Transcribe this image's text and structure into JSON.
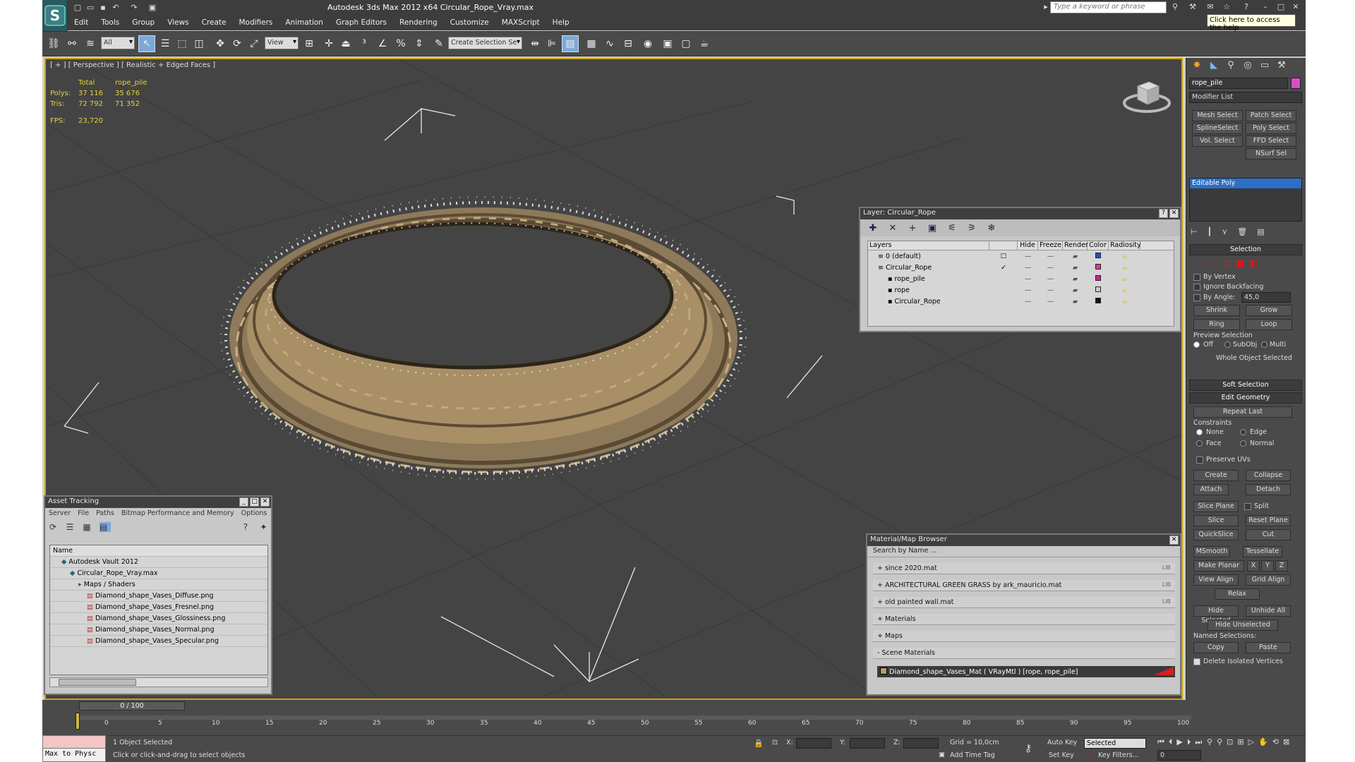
{
  "titlebar": {
    "title": "Autodesk 3ds Max  2012 x64     Circular_Rope_Vray.max",
    "search_placeholder": "Type a keyword or phrase",
    "tooltip": "Click here to access the help"
  },
  "menu": [
    "Edit",
    "Tools",
    "Group",
    "Views",
    "Create",
    "Modifiers",
    "Animation",
    "Graph Editors",
    "Rendering",
    "Customize",
    "MAXScript",
    "Help"
  ],
  "toolbar": {
    "filter": "All",
    "refcoord": "View",
    "selection_set": "Create Selection Se"
  },
  "viewport": {
    "label": "[ + ] [ Perspective ] [ Realistic + Edged Faces ]",
    "stats": {
      "total_label": "Total",
      "obj_label": "rope_pile",
      "polys_label": "Polys:",
      "polys_total": "37 116",
      "polys_obj": "35 676",
      "tris_label": "Tris:",
      "tris_total": "72 792",
      "tris_obj": "71 352",
      "fps_label": "FPS:",
      "fps": "23,720"
    }
  },
  "layer_dialog": {
    "title": "Layer: Circular_Rope",
    "columns": [
      "Layers",
      "Hide",
      "Freeze",
      "Render",
      "Color",
      "Radiosity"
    ],
    "rows": [
      {
        "name": "0 (default)",
        "indent": 0,
        "color": "#1f4fd8"
      },
      {
        "name": "Circular_Rope",
        "indent": 0,
        "color": "#d83aa0"
      },
      {
        "name": "rope_pile",
        "indent": 1,
        "color": "#d41f9e"
      },
      {
        "name": "rope",
        "indent": 1,
        "color": "#c8c8c8"
      },
      {
        "name": "Circular_Rope",
        "indent": 1,
        "color": "#111111"
      }
    ]
  },
  "asset_dialog": {
    "title": "Asset Tracking",
    "menu": [
      "Server",
      "File",
      "Paths",
      "Bitmap Performance and Memory",
      "Options"
    ],
    "column": "Name",
    "rows": [
      {
        "label": "Autodesk Vault 2012",
        "indent": 1
      },
      {
        "label": "Circular_Rope_Vray.max",
        "indent": 2
      },
      {
        "label": "Maps / Shaders",
        "indent": 3
      },
      {
        "label": "Diamond_shape_Vases_Diffuse.png",
        "indent": 4
      },
      {
        "label": "Diamond_shape_Vases_Fresnel.png",
        "indent": 4
      },
      {
        "label": "Diamond_shape_Vases_Glossiness.png",
        "indent": 4
      },
      {
        "label": "Diamond_shape_Vases_Normal.png",
        "indent": 4
      },
      {
        "label": "Diamond_shape_Vases_Specular.png",
        "indent": 4
      }
    ]
  },
  "material_dialog": {
    "title": "Material/Map Browser",
    "search": "Search by Name ...",
    "lib_tag": "LIB",
    "groups": [
      {
        "label": "+ since 2020.mat",
        "lib": true
      },
      {
        "label": "+ ARCHITECTURAL GREEN GRASS by ark_mauricio.mat",
        "lib": true
      },
      {
        "label": "+ old painted wall.mat",
        "lib": true
      },
      {
        "label": "+ Materials",
        "lib": false
      },
      {
        "label": "+ Maps",
        "lib": false
      },
      {
        "label": "- Scene Materials",
        "lib": false
      }
    ],
    "scene_material": "Diamond_shape_Vases_Mat  ( VRayMtl )  [rope, rope_pile]"
  },
  "command_panel": {
    "object_name": "rope_pile",
    "object_color": "#d94dca",
    "modifier_list": "Modifier List",
    "mod_buttons": [
      "Mesh Select",
      "Patch Select",
      "SplineSelect",
      "Poly Select",
      "Vol. Select",
      "FFD Select",
      "NSurf Sel"
    ],
    "stack_item": "Editable Poly",
    "selection": {
      "header": "Selection",
      "by_vertex": "By Vertex",
      "ignore_backfacing": "Ignore Backfacing",
      "by_angle": "By Angle:",
      "angle_value": "45,0",
      "shrink": "Shrink",
      "grow": "Grow",
      "ring": "Ring",
      "loop": "Loop",
      "preview_selection": "Preview Selection",
      "off": "Off",
      "subobj": "SubObj",
      "multi": "Multi",
      "status": "Whole Object Selected"
    },
    "soft_selection": "Soft Selection",
    "edit_geometry": "Edit Geometry",
    "repeat_last": "Repeat Last",
    "constraints": "Constraints",
    "c_none": "None",
    "c_edge": "Edge",
    "c_face": "Face",
    "c_normal": "Normal",
    "preserve_uvs": "Preserve UVs",
    "create": "Create",
    "collapse": "Collapse",
    "attach": "Attach",
    "detach": "Detach",
    "slice_plane": "Slice Plane",
    "split": "Split",
    "slice": "Slice",
    "reset_plane": "Reset Plane",
    "quickslice": "QuickSlice",
    "cut": "Cut",
    "msmooth": "MSmooth",
    "tessellate": "Tessellate",
    "make_planar": "Make Planar",
    "x": "X",
    "y": "Y",
    "z": "Z",
    "view_align": "View Align",
    "grid_align": "Grid Align",
    "relax": "Relax",
    "hide_selected": "Hide Selected",
    "unhide_all": "Unhide All",
    "hide_unselected": "Hide Unselected",
    "named_selections": "Named Selections:",
    "copy": "Copy",
    "paste": "Paste",
    "delete_isolated": "Delete Isolated Vertices"
  },
  "timeline": {
    "slider": "0 / 100",
    "ticks": [
      "0",
      "5",
      "10",
      "15",
      "20",
      "25",
      "30",
      "35",
      "40",
      "45",
      "50",
      "55",
      "60",
      "65",
      "70",
      "75",
      "80",
      "85",
      "90",
      "95",
      "100"
    ]
  },
  "status": {
    "maxscript": "Max to Physc",
    "objects": "1 Object Selected",
    "hint": "Click or click-and-drag to select objects",
    "x": "X:",
    "y": "Y:",
    "z": "Z:",
    "grid": "Grid = 10,0cm",
    "add_time_tag": "Add Time Tag",
    "auto_key": "Auto Key",
    "set_key": "Set Key",
    "selected": "Selected",
    "key_filters": "Key Filters...",
    "frame": "0"
  }
}
